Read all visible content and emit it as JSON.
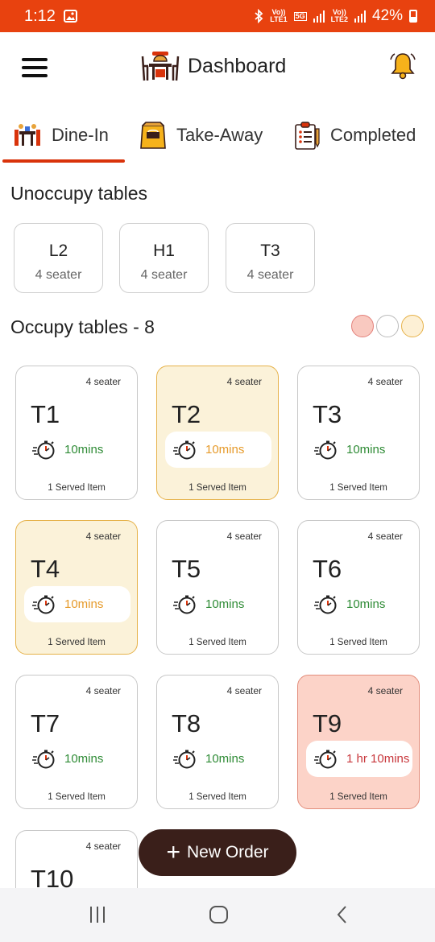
{
  "status_bar": {
    "time": "1:12",
    "net1_top": "Vo))",
    "net1_bottom": "LTE1",
    "net_5g": "5G",
    "net2_top": "Vo))",
    "net2_bottom": "LTE2",
    "battery": "42%"
  },
  "appbar": {
    "title": "Dashboard"
  },
  "tabs": [
    {
      "label": "Dine-In",
      "active": true
    },
    {
      "label": "Take-Away",
      "active": false
    },
    {
      "label": "Completed",
      "active": false
    }
  ],
  "unoccupied": {
    "title": "Unoccupy tables",
    "tables": [
      {
        "name": "L2",
        "seats": "4 seater"
      },
      {
        "name": "H1",
        "seats": "4 seater"
      },
      {
        "name": "T3",
        "seats": "4 seater"
      }
    ]
  },
  "occupied": {
    "title": "Occupy tables - 8",
    "legend_colors": [
      "#f9c9c0",
      "#ffffff",
      "#fdf0d5"
    ],
    "tables": [
      {
        "name": "T1",
        "seats": "4 seater",
        "time": "10mins",
        "served": "1 Served Item",
        "state": "normal"
      },
      {
        "name": "T2",
        "seats": "4 seater",
        "time": "10mins",
        "served": "1 Served Item",
        "state": "warn"
      },
      {
        "name": "T3",
        "seats": "4 seater",
        "time": "10mins",
        "served": "1 Served Item",
        "state": "normal"
      },
      {
        "name": "T4",
        "seats": "4 seater",
        "time": "10mins",
        "served": "1 Served Item",
        "state": "warn"
      },
      {
        "name": "T5",
        "seats": "4 seater",
        "time": "10mins",
        "served": "1 Served Item",
        "state": "normal"
      },
      {
        "name": "T6",
        "seats": "4 seater",
        "time": "10mins",
        "served": "1 Served Item",
        "state": "normal"
      },
      {
        "name": "T7",
        "seats": "4 seater",
        "time": "10mins",
        "served": "1 Served Item",
        "state": "normal"
      },
      {
        "name": "T8",
        "seats": "4 seater",
        "time": "10mins",
        "served": "1 Served Item",
        "state": "normal"
      },
      {
        "name": "T9",
        "seats": "4 seater",
        "time": "1 hr 10mins",
        "served": "1 Served Item",
        "state": "alert"
      },
      {
        "name": "T10",
        "seats": "4 seater"
      }
    ]
  },
  "fab": {
    "label": "New Order",
    "icon": "plus-icon"
  },
  "colors": {
    "status_bar": "#e8420f",
    "accent": "#d9330b",
    "fab": "#3a1f1a",
    "timer_green": "#2e8b35",
    "timer_orange": "#e69a2a",
    "timer_red": "#c8373c"
  }
}
